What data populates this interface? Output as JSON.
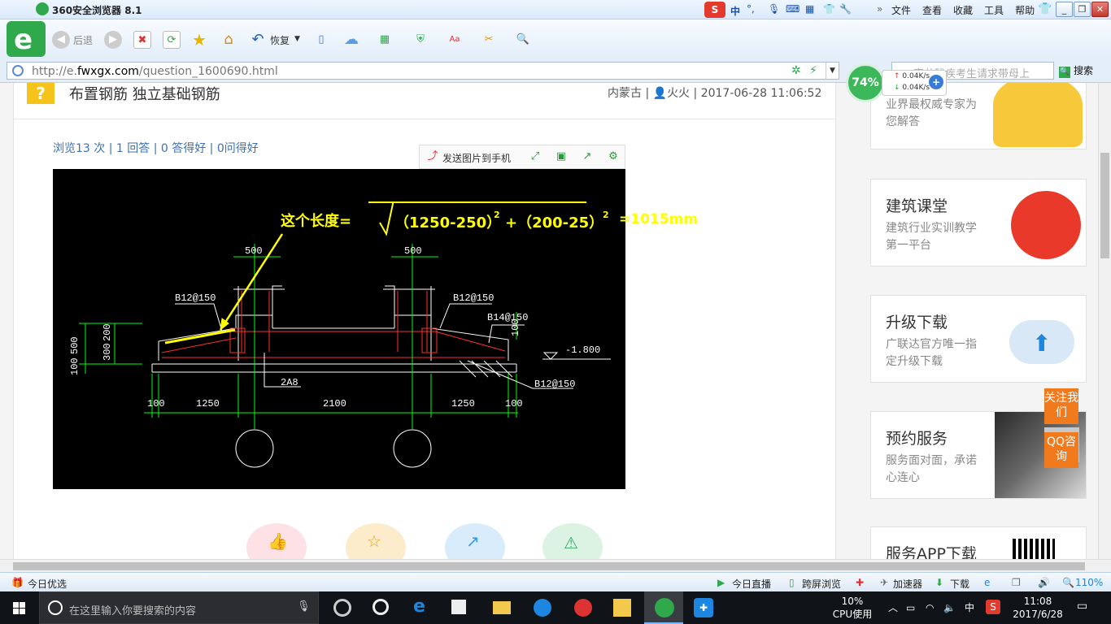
{
  "browser": {
    "title": "360安全浏览器 8.1",
    "menu": [
      "文件",
      "查看",
      "收藏",
      "工具",
      "帮助"
    ],
    "ime": {
      "lang": "中"
    },
    "toolbar": {
      "back": "后退",
      "restore": "恢复"
    },
    "address": {
      "url_prefix": "http://e.",
      "url_domain": "fwxgx.com",
      "url_path": "/question_1600690.html"
    },
    "search": {
      "placeholder": "高分残疾考生请求带母上",
      "button": "搜索"
    },
    "net": {
      "percent": "74%",
      "up": "0.04K/s",
      "down": "0.04K/s"
    }
  },
  "question": {
    "icon": "?",
    "title": "布置钢筋 独立基础钢筋",
    "region": "内蒙古",
    "user": "火火",
    "date": "2017-06-28 11:06:52",
    "stats": "浏览13 次 | 1 回答 | 0 答得好 | 0问得好",
    "send_to_phone": "发送图片到手机"
  },
  "drawing": {
    "formula_label": "这个长度=",
    "term1": "（1250-250）",
    "term2": "+（200-25）",
    "exp1": "2",
    "exp2": "2",
    "result": "=1015mm",
    "dim_500_left": "500",
    "dim_500_right": "500",
    "rebar_b12_left": "B12@150",
    "rebar_b12_right": "B12@150",
    "rebar_b14": "B14@150",
    "rebar_2a8": "2A8",
    "rebar_b12_bottom": "B12@150",
    "elev": "-1.800",
    "v100a": "100",
    "v500": "500",
    "v300": "300",
    "v200": "200",
    "v100b": "100",
    "v100c": "100",
    "d100l": "100",
    "d1250l": "1250",
    "d2100": "2100",
    "d1250r": "1250",
    "d100r": "100"
  },
  "sidebar": {
    "cards": [
      {
        "title": "",
        "desc": "业界最权威专家为您解答"
      },
      {
        "title": "建筑课堂",
        "desc": "建筑行业实训教学第一平台"
      },
      {
        "title": "升级下载",
        "desc": "广联达官方唯一指定升级下载"
      },
      {
        "title": "预约服务",
        "desc": "服务面对面，承诺心连心"
      },
      {
        "title": "服务APP下载",
        "desc": ""
      }
    ],
    "follow": "关注我们",
    "qq": "QQ咨询"
  },
  "statusbar": {
    "today_pick": "今日优选",
    "today_live": "今日直播",
    "cross_screen": "跨屏浏览",
    "accelerator": "加速器",
    "download": "下载",
    "zoom": "110%"
  },
  "taskbar": {
    "search_placeholder": "在这里输入你要搜索的内容",
    "cpu_percent": "10%",
    "cpu_label": "CPU使用",
    "ime": "中",
    "time": "11:08",
    "date": "2017/6/28"
  },
  "colors": {
    "accent_green": "#2fa94b",
    "link_blue": "#3a70b8",
    "cad_yellow": "#ffff00",
    "orange": "#f07a1c"
  }
}
